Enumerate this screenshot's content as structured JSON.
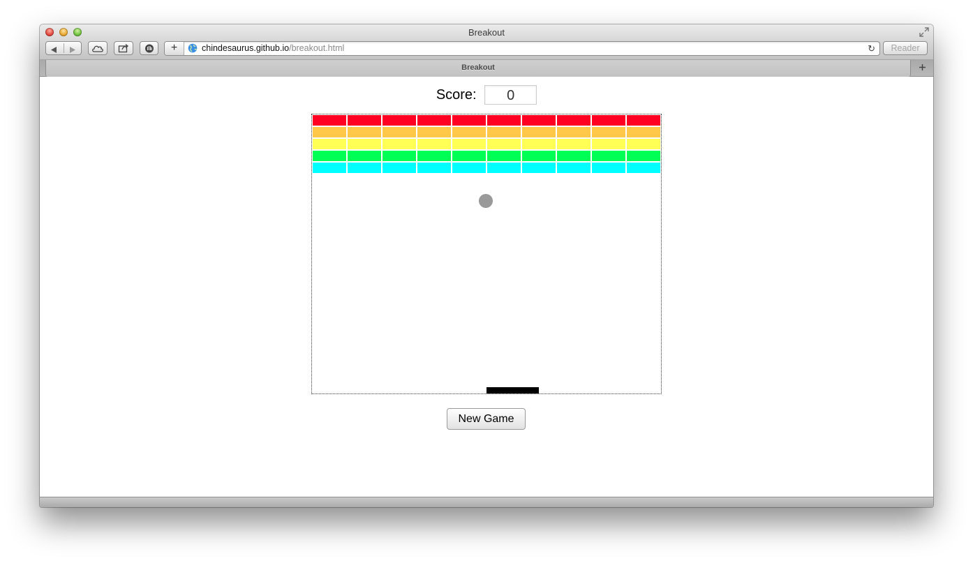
{
  "window": {
    "title": "Breakout"
  },
  "toolbar": {
    "url_host": "chindesaurus.github.io",
    "url_path": "/breakout.html",
    "reader_label": "Reader",
    "new_tab_glyph": "+",
    "reload_glyph": "↻"
  },
  "tab": {
    "title": "Breakout"
  },
  "game": {
    "score_label": "Score:",
    "score_value": "0",
    "new_game_label": "New Game",
    "brick_rows": [
      {
        "color": "#ff0022",
        "count": 10
      },
      {
        "color": "#ffc848",
        "count": 10
      },
      {
        "color": "#ffff55",
        "count": 10
      },
      {
        "color": "#00ff55",
        "count": 10
      },
      {
        "color": "#00ffff",
        "count": 10
      }
    ],
    "ball_color": "#999999",
    "paddle_color": "#000000"
  }
}
